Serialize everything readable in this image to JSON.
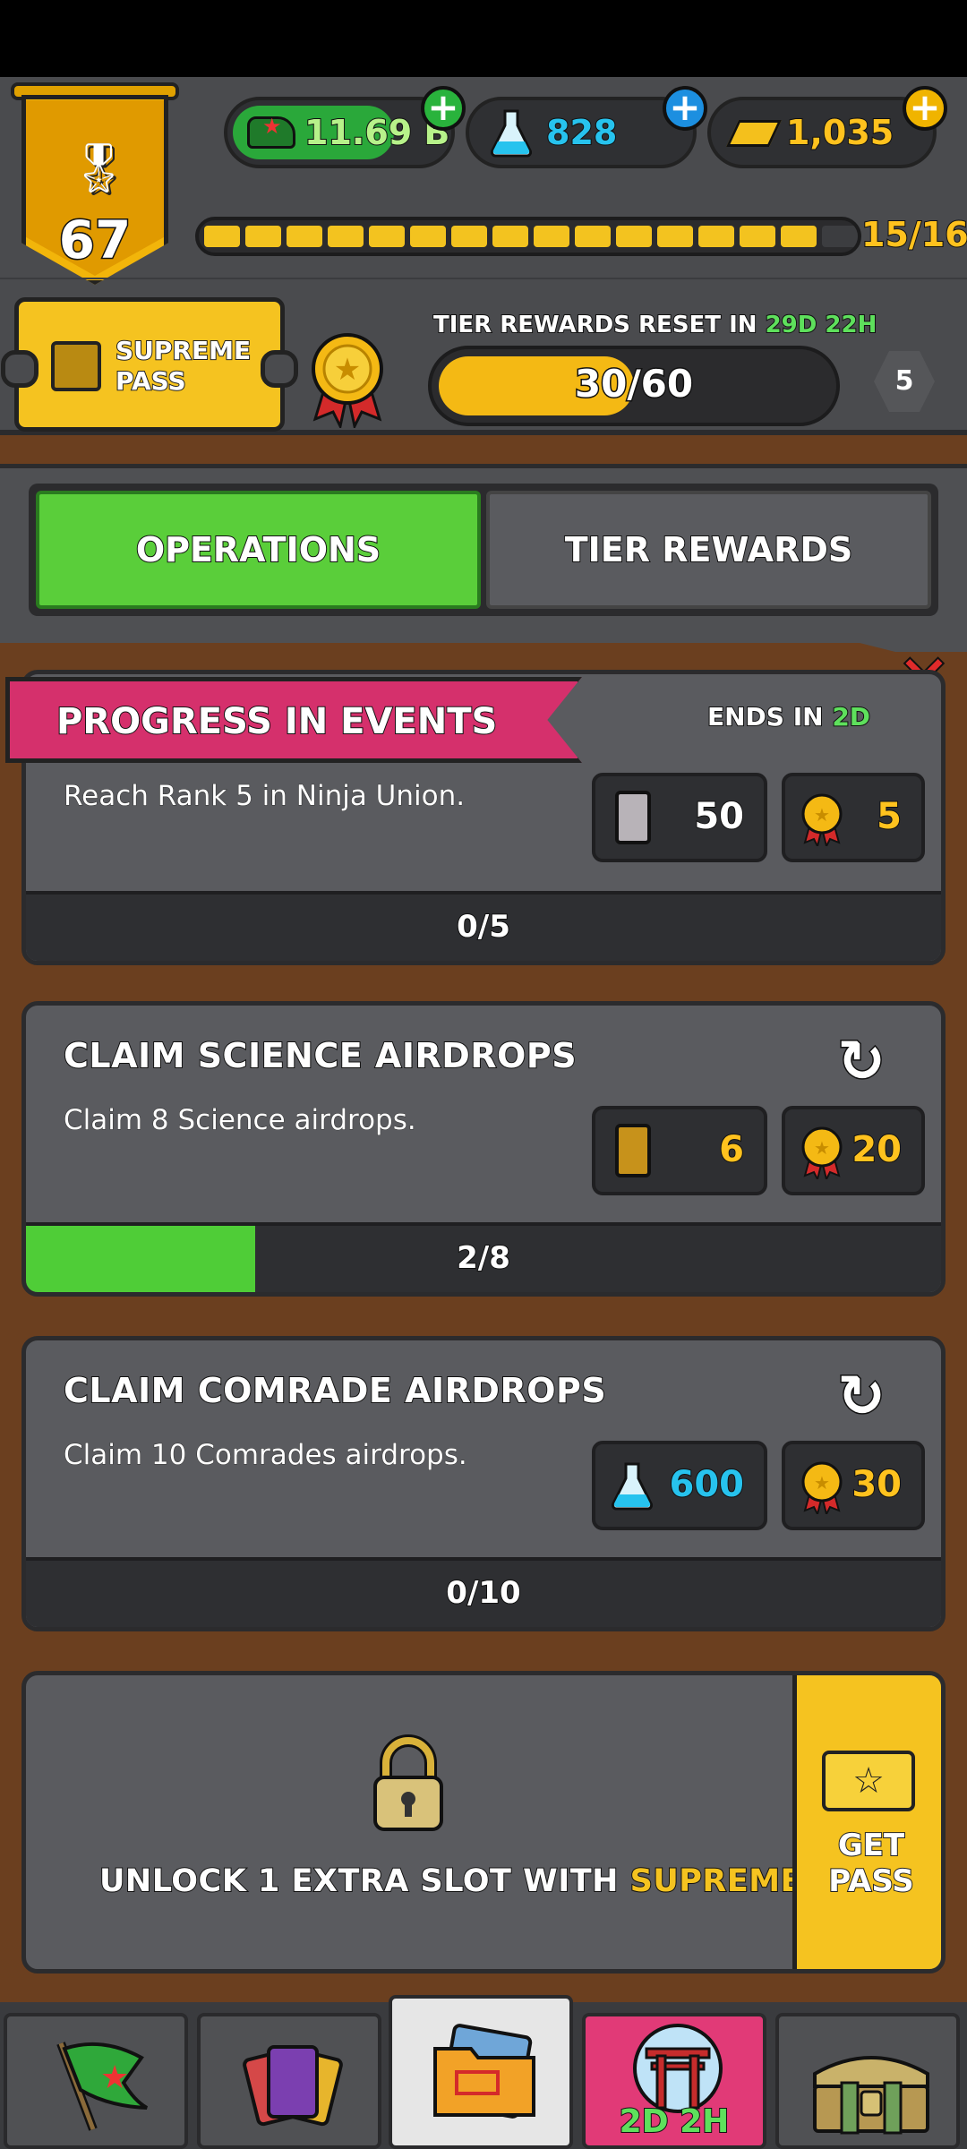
{
  "header": {
    "level": "67",
    "resources": {
      "cash": "11.69 B",
      "science": "828",
      "gold": "1,035"
    },
    "xp": {
      "text": "15/16",
      "filled": 15,
      "total": 16
    },
    "supreme_pass_label": "SUPREME PASS",
    "tier_reset_label": "TIER REWARDS RESET IN",
    "tier_reset_days": "29D",
    "tier_reset_hours": "22H",
    "tier_progress_text": "30/60",
    "tier_progress": 0.5,
    "tier_level": "5"
  },
  "tabs": {
    "operations": "OPERATIONS",
    "tier_rewards": "TIER REWARDS"
  },
  "event": {
    "ribbon": "PROGRESS IN EVENTS",
    "ends_label": "ENDS IN",
    "ends_value": "2D",
    "desc": "Reach Rank 5 in Ninja Union.",
    "reward1": "50",
    "reward2": "5",
    "progress_text": "0/5",
    "progress": 0
  },
  "missions": [
    {
      "title": "CLAIM SCIENCE AIRDROPS",
      "desc": "Claim 8 Science airdrops.",
      "reward1": "6",
      "reward2": "20",
      "progress_text": "2/8",
      "progress": 0.25
    },
    {
      "title": "CLAIM COMRADE AIRDROPS",
      "desc": "Claim 10 Comrades airdrops.",
      "reward1": "600",
      "reward2": "30",
      "progress_text": "0/10",
      "progress": 0
    }
  ],
  "locked": {
    "msg_prefix": "UNLOCK 1 EXTRA SLOT WITH",
    "msg_highlight": "SUPREME PASS",
    "get_pass": "GET PASS"
  },
  "nav": {
    "timer": "2D 2H"
  },
  "colors": {
    "accent_green": "#5ace3a",
    "gold": "#f5c320",
    "science_blue": "#27c3ee",
    "ribbon_pink": "#d5306c"
  }
}
